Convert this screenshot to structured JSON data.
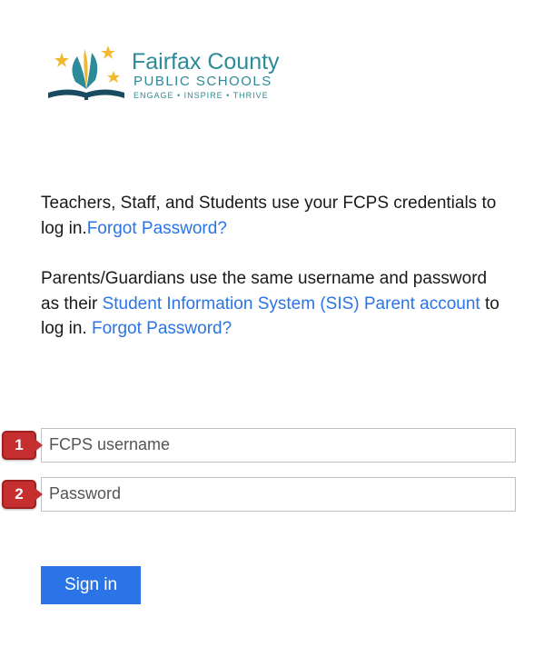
{
  "logo": {
    "line1": "Fairfax County",
    "line2": "PUBLIC SCHOOLS",
    "tagline_parts": [
      "ENGAGE",
      "INSPIRE",
      "THRIVE"
    ],
    "tagline_sep": " • ",
    "colors": {
      "teal": "#2d8a98",
      "gold": "#f2b82d",
      "navy": "#1a4a60"
    }
  },
  "instructions": {
    "p1_text": "Teachers, Staff, and Students use your FCPS credentials to log in.",
    "p1_link": "Forgot Password?",
    "p2_pre": "Parents/Guardians use the same username and password as their ",
    "p2_link1": "Student Information System (SIS) Parent account",
    "p2_mid": " to log in. ",
    "p2_link2": "Forgot Password?"
  },
  "form": {
    "markers": {
      "username": "1",
      "password": "2"
    },
    "username_placeholder": "FCPS username",
    "password_placeholder": "Password",
    "signin_label": "Sign in"
  }
}
